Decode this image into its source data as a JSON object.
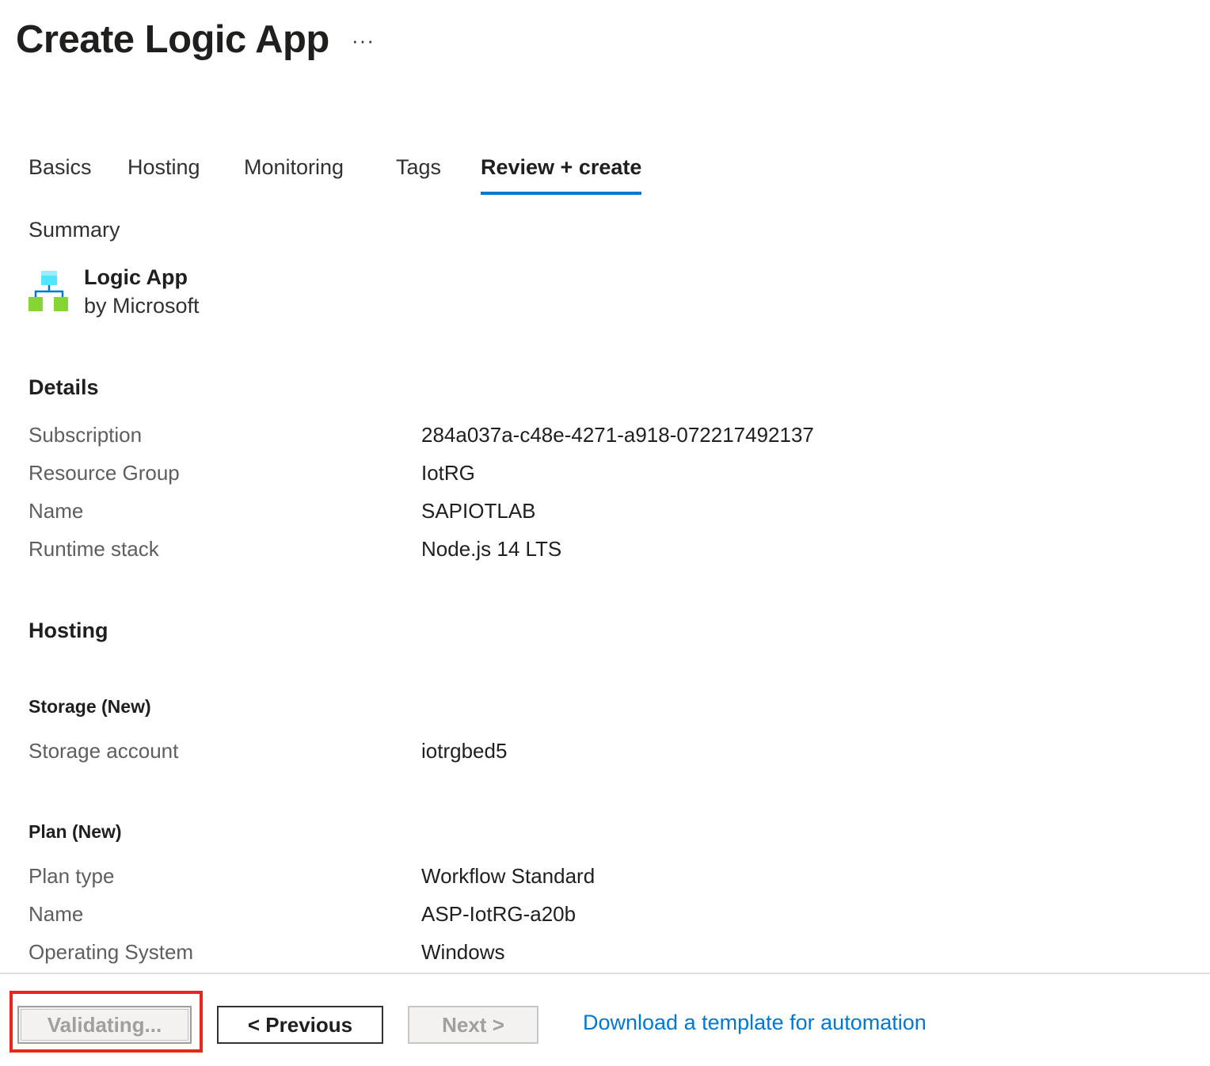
{
  "header": {
    "title": "Create Logic App",
    "more_label": "···"
  },
  "tabs": [
    {
      "label": "Basics"
    },
    {
      "label": "Hosting"
    },
    {
      "label": "Monitoring"
    },
    {
      "label": "Tags"
    },
    {
      "label": "Review + create",
      "active": true
    }
  ],
  "summary": {
    "heading": "Summary",
    "product_name": "Logic App",
    "publisher": "by Microsoft",
    "icon": "logic-app-icon"
  },
  "details": {
    "heading": "Details",
    "rows": [
      {
        "label": "Subscription",
        "value": "284a037a-c48e-4271-a918-072217492137"
      },
      {
        "label": "Resource Group",
        "value": "IotRG"
      },
      {
        "label": "Name",
        "value": "SAPIOTLAB"
      },
      {
        "label": "Runtime stack",
        "value": "Node.js 14 LTS"
      }
    ]
  },
  "hosting": {
    "heading": "Hosting",
    "storage": {
      "heading": "Storage (New)",
      "rows": [
        {
          "label": "Storage account",
          "value": "iotrgbed5"
        }
      ]
    },
    "plan": {
      "heading": "Plan (New)",
      "rows": [
        {
          "label": "Plan type",
          "value": "Workflow Standard"
        },
        {
          "label": "Name",
          "value": "ASP-IotRG-a20b"
        },
        {
          "label": "Operating System",
          "value": "Windows"
        }
      ]
    }
  },
  "footer": {
    "validating_label": "Validating...",
    "previous_label": "< Previous",
    "next_label": "Next >",
    "download_link": "Download a template for automation"
  },
  "colors": {
    "accent": "#0078d4",
    "highlight": "#e8271a",
    "icon_blue": "#50e6ff",
    "icon_green": "#86d633"
  }
}
